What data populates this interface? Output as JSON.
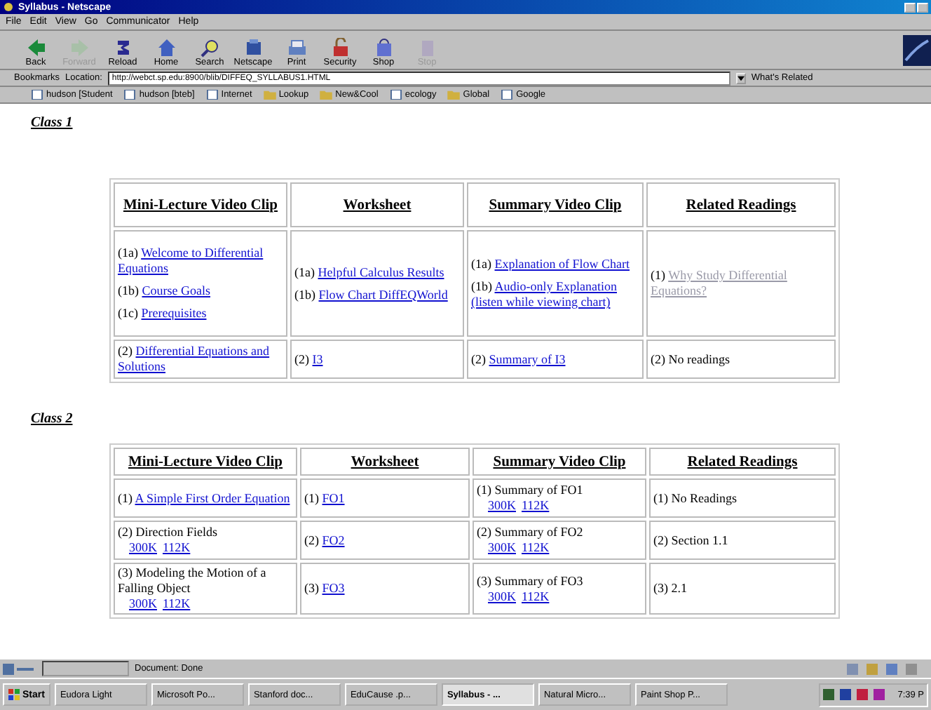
{
  "window": {
    "title": "Syllabus - Netscape"
  },
  "menu": [
    "File",
    "Edit",
    "View",
    "Go",
    "Communicator",
    "Help"
  ],
  "toolbar": [
    {
      "label": "Back",
      "disabled": false
    },
    {
      "label": "Forward",
      "disabled": true
    },
    {
      "label": "Reload",
      "disabled": false
    },
    {
      "label": "Home",
      "disabled": false
    },
    {
      "label": "Search",
      "disabled": false
    },
    {
      "label": "Netscape",
      "disabled": false
    },
    {
      "label": "Print",
      "disabled": false
    },
    {
      "label": "Security",
      "disabled": false
    },
    {
      "label": "Shop",
      "disabled": false
    },
    {
      "label": "Stop",
      "disabled": true
    }
  ],
  "location": {
    "bookmarks": "Bookmarks",
    "label": "Location:",
    "url": "http://webct.sp.edu:8900/blib/DIFFEQ_SYLLABUS1.HTML",
    "related": "What's Related"
  },
  "personal_toolbar": [
    {
      "label": "hudson [Student",
      "kind": "page"
    },
    {
      "label": "hudson [bteb]",
      "kind": "page"
    },
    {
      "label": "Internet",
      "kind": "page"
    },
    {
      "label": "Lookup",
      "kind": "folder"
    },
    {
      "label": "New&Cool",
      "kind": "folder"
    },
    {
      "label": "ecology",
      "kind": "page"
    },
    {
      "label": "Global",
      "kind": "folder"
    },
    {
      "label": "Google",
      "kind": "page"
    }
  ],
  "sections": [
    {
      "heading": "Class 1",
      "columns": [
        "Mini-Lecture Video Clip",
        "Worksheet",
        "Summary Video Clip",
        "Related Readings"
      ],
      "rows": [
        [
          [
            {
              "prefix": "(1a)",
              "link": "Welcome to Differential Equations",
              "visited": false
            },
            {
              "prefix": "(1b)",
              "link": "Course Goals",
              "visited": false
            },
            {
              "prefix": "(1c)",
              "link": "Prerequisites",
              "visited": false
            }
          ],
          [
            {
              "prefix": "(1a)",
              "link": "Helpful Calculus Results",
              "visited": false
            },
            {
              "prefix": "(1b)",
              "link": "Flow Chart DiffEQWorld",
              "visited": false
            }
          ],
          [
            {
              "prefix": "(1a)",
              "link": "Explanation of Flow Chart",
              "visited": false
            },
            {
              "prefix": "(1b)",
              "link": "Audio-only Explanation (listen while viewing chart)",
              "visited": false
            }
          ],
          [
            {
              "prefix": "(1)",
              "link": "Why Study Differential Equations?",
              "visited": true
            }
          ]
        ],
        [
          [
            {
              "prefix": "(2)",
              "link": "Differential Equations and Solutions",
              "visited": false
            }
          ],
          [
            {
              "prefix": "(2)",
              "link": "I3",
              "visited": false
            }
          ],
          [
            {
              "prefix": "(2)",
              "link": "Summary of I3",
              "visited": false
            }
          ],
          [
            {
              "text": "(2) No readings"
            }
          ]
        ]
      ]
    },
    {
      "heading": "Class 2",
      "columns": [
        "Mini-Lecture Video Clip",
        "Worksheet",
        "Summary Video Clip",
        "Related Readings"
      ],
      "rows": [
        [
          [
            {
              "prefix": "(1)",
              "link": "A Simple First Order Equation",
              "visited": false
            }
          ],
          [
            {
              "prefix": "(1)",
              "link": "FO1",
              "visited": false
            }
          ],
          [
            {
              "text": "(1) Summary of FO1",
              "sizes": [
                "300K",
                "112K"
              ]
            }
          ],
          [
            {
              "text": "(1) No Readings"
            }
          ]
        ],
        [
          [
            {
              "text": "(2) Direction Fields",
              "sizes": [
                "300K",
                "112K"
              ]
            }
          ],
          [
            {
              "prefix": "(2)",
              "link": "FO2",
              "visited": false
            }
          ],
          [
            {
              "text": "(2) Summary of FO2",
              "sizes": [
                "300K",
                "112K"
              ]
            }
          ],
          [
            {
              "text": "(2) Section 1.1"
            }
          ]
        ],
        [
          [
            {
              "text": "(3) Modeling the Motion of a Falling Object",
              "sizes": [
                "300K",
                "112K"
              ]
            }
          ],
          [
            {
              "prefix": "(3)",
              "link": "FO3",
              "visited": false
            }
          ],
          [
            {
              "text": "(3) Summary of FO3",
              "sizes": [
                "300K",
                "112K"
              ]
            }
          ],
          [
            {
              "text": "(3) 2.1"
            }
          ]
        ]
      ]
    }
  ],
  "status_bar": {
    "text": "Document: Done"
  },
  "taskbar": {
    "start": "Start",
    "tasks": [
      {
        "label": "Eudora Light",
        "selected": false
      },
      {
        "label": "Microsoft Po...",
        "selected": false
      },
      {
        "label": "Stanford doc...",
        "selected": false
      },
      {
        "label": "EduCause .p...",
        "selected": false
      },
      {
        "label": "Syllabus - ...",
        "selected": true
      },
      {
        "label": "Natural Micro...",
        "selected": false
      },
      {
        "label": "Paint Shop P...",
        "selected": false
      }
    ],
    "clock": "7:39 P"
  }
}
